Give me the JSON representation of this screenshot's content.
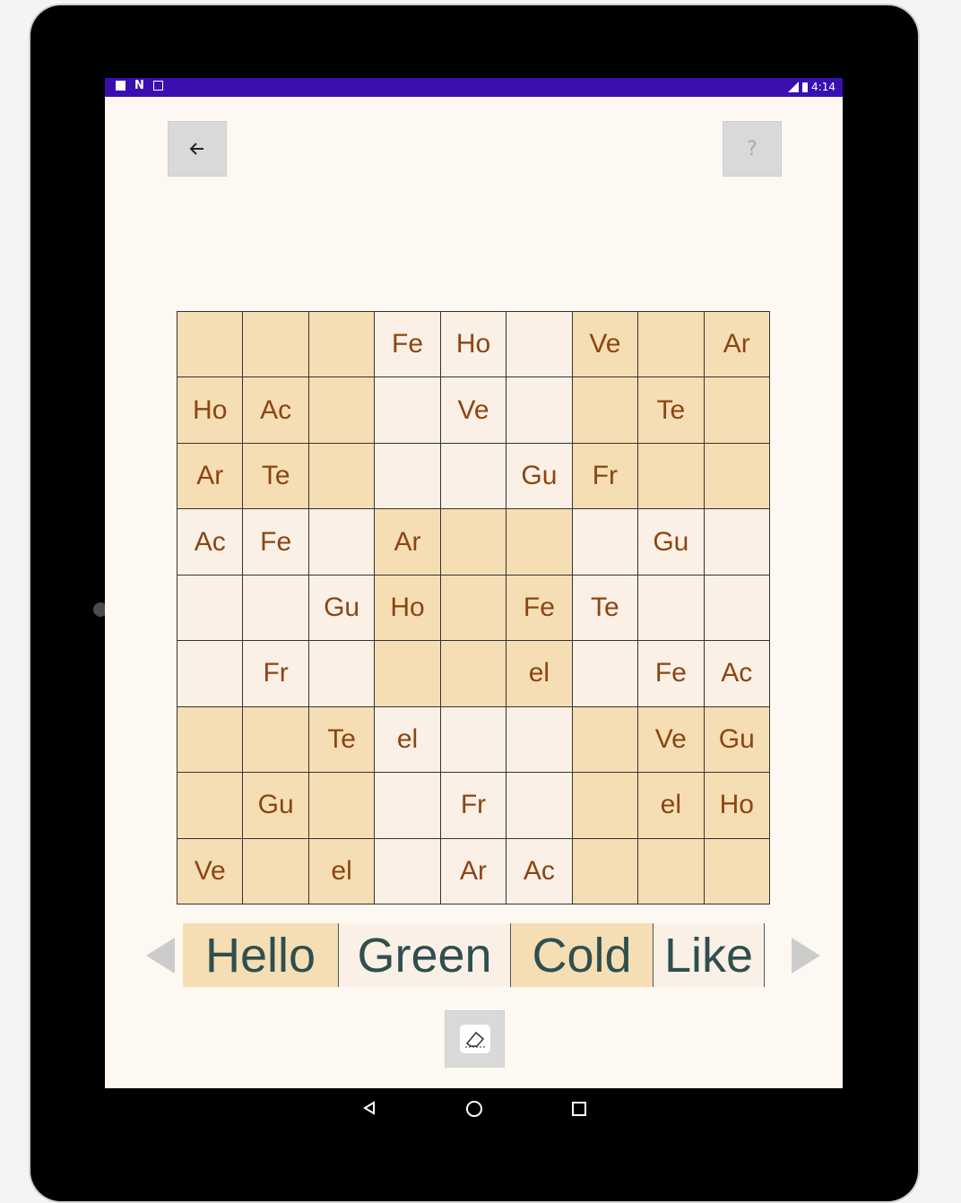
{
  "status_bar": {
    "time": "4:14",
    "left_icons": [
      "sd-card-icon",
      "n-icon",
      "a-icon"
    ],
    "right_icons": [
      "lte-signal-icon",
      "battery-icon"
    ]
  },
  "toolbar": {
    "back_icon": "arrow-left-icon",
    "help_label": "?"
  },
  "grid": {
    "rows": [
      [
        {
          "t": "",
          "s": "dark"
        },
        {
          "t": "",
          "s": "dark"
        },
        {
          "t": "",
          "s": "dark"
        },
        {
          "t": "Fe",
          "s": "light"
        },
        {
          "t": "Ho",
          "s": "light"
        },
        {
          "t": "",
          "s": "light"
        },
        {
          "t": "Ve",
          "s": "dark"
        },
        {
          "t": "",
          "s": "dark"
        },
        {
          "t": "Ar",
          "s": "dark"
        }
      ],
      [
        {
          "t": "Ho",
          "s": "dark"
        },
        {
          "t": "Ac",
          "s": "dark"
        },
        {
          "t": "",
          "s": "dark"
        },
        {
          "t": "",
          "s": "light"
        },
        {
          "t": "Ve",
          "s": "light"
        },
        {
          "t": "",
          "s": "light"
        },
        {
          "t": "",
          "s": "dark"
        },
        {
          "t": "Te",
          "s": "dark"
        },
        {
          "t": "",
          "s": "dark"
        }
      ],
      [
        {
          "t": "Ar",
          "s": "dark"
        },
        {
          "t": "Te",
          "s": "dark"
        },
        {
          "t": "",
          "s": "dark"
        },
        {
          "t": "",
          "s": "light"
        },
        {
          "t": "",
          "s": "light"
        },
        {
          "t": "Gu",
          "s": "light"
        },
        {
          "t": "Fr",
          "s": "dark"
        },
        {
          "t": "",
          "s": "dark"
        },
        {
          "t": "",
          "s": "dark"
        }
      ],
      [
        {
          "t": "Ac",
          "s": "light"
        },
        {
          "t": "Fe",
          "s": "light"
        },
        {
          "t": "",
          "s": "light"
        },
        {
          "t": "Ar",
          "s": "dark"
        },
        {
          "t": "",
          "s": "dark"
        },
        {
          "t": "",
          "s": "dark"
        },
        {
          "t": "",
          "s": "light"
        },
        {
          "t": "Gu",
          "s": "light"
        },
        {
          "t": "",
          "s": "light"
        }
      ],
      [
        {
          "t": "",
          "s": "light"
        },
        {
          "t": "",
          "s": "light"
        },
        {
          "t": "Gu",
          "s": "light"
        },
        {
          "t": "Ho",
          "s": "dark"
        },
        {
          "t": "",
          "s": "dark"
        },
        {
          "t": "Fe",
          "s": "dark"
        },
        {
          "t": "Te",
          "s": "light"
        },
        {
          "t": "",
          "s": "light"
        },
        {
          "t": "",
          "s": "light"
        }
      ],
      [
        {
          "t": "",
          "s": "light"
        },
        {
          "t": "Fr",
          "s": "light"
        },
        {
          "t": "",
          "s": "light"
        },
        {
          "t": "",
          "s": "dark"
        },
        {
          "t": "",
          "s": "dark"
        },
        {
          "t": "el",
          "s": "dark"
        },
        {
          "t": "",
          "s": "light"
        },
        {
          "t": "Fe",
          "s": "light"
        },
        {
          "t": "Ac",
          "s": "light"
        }
      ],
      [
        {
          "t": "",
          "s": "dark"
        },
        {
          "t": "",
          "s": "dark"
        },
        {
          "t": "Te",
          "s": "dark"
        },
        {
          "t": "el",
          "s": "light"
        },
        {
          "t": "",
          "s": "light"
        },
        {
          "t": "",
          "s": "light"
        },
        {
          "t": "",
          "s": "dark"
        },
        {
          "t": "Ve",
          "s": "dark"
        },
        {
          "t": "Gu",
          "s": "dark"
        }
      ],
      [
        {
          "t": "",
          "s": "dark"
        },
        {
          "t": "Gu",
          "s": "dark"
        },
        {
          "t": "",
          "s": "dark"
        },
        {
          "t": "",
          "s": "light"
        },
        {
          "t": "Fr",
          "s": "light"
        },
        {
          "t": "",
          "s": "light"
        },
        {
          "t": "",
          "s": "dark"
        },
        {
          "t": "el",
          "s": "dark"
        },
        {
          "t": "Ho",
          "s": "dark"
        }
      ],
      [
        {
          "t": "Ve",
          "s": "dark"
        },
        {
          "t": "",
          "s": "dark"
        },
        {
          "t": "el",
          "s": "dark"
        },
        {
          "t": "",
          "s": "light"
        },
        {
          "t": "Ar",
          "s": "light"
        },
        {
          "t": "Ac",
          "s": "light"
        },
        {
          "t": "",
          "s": "dark"
        },
        {
          "t": "",
          "s": "dark"
        },
        {
          "t": "",
          "s": "dark"
        }
      ]
    ]
  },
  "words": [
    {
      "label": "Hello",
      "s": "dark"
    },
    {
      "label": "Green",
      "s": "light"
    },
    {
      "label": "Cold",
      "s": "dark"
    },
    {
      "label": "Like",
      "s": "light"
    }
  ],
  "colors": {
    "dark_cell": "#f5deb3",
    "light_cell": "#faf0e6",
    "cell_text": "#8b4513",
    "word_text": "#2f4f4f",
    "status_bar": "#3a0fb0"
  }
}
